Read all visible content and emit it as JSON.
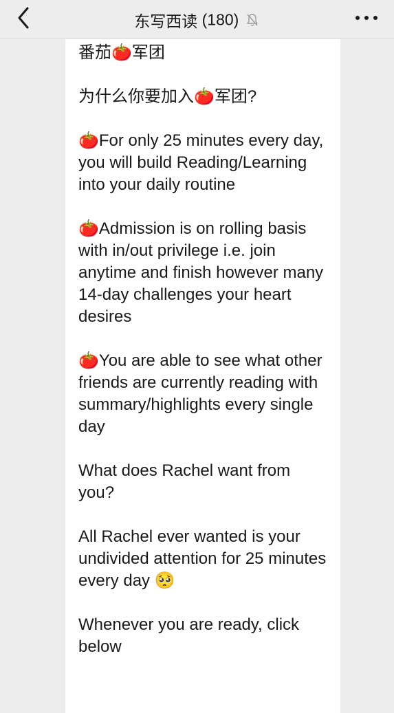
{
  "header": {
    "back_label": "<",
    "group_name": "东写西读",
    "member_count": "(180)",
    "more_label": "•••"
  },
  "message": {
    "paragraphs": [
      "番茄🍅军团",
      "为什么你要加入🍅军团?",
      "🍅For only 25 minutes every day, you will build Reading/Learning into your daily routine",
      "🍅Admission is on rolling basis with in/out privilege i.e. join anytime and finish however many 14-day challenges your heart desires",
      "🍅You are able to see what other friends are currently reading with summary/highlights every single day",
      "What does Rachel want from you?",
      "All Rachel ever wanted is your undivided attention for 25 minutes every day 🥺",
      "Whenever you are ready, click below"
    ]
  },
  "colors": {
    "nav_bg": "#ededed",
    "bubble_bg": "#ffffff",
    "text": "#191919"
  },
  "icons": {
    "back": "chevron-left-icon",
    "mute": "bell-slash-icon",
    "more": "ellipsis-icon"
  }
}
